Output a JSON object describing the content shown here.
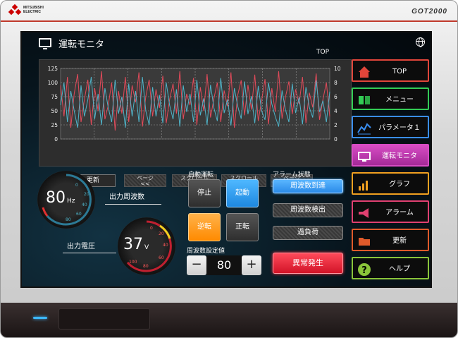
{
  "device": {
    "brand_line1": "MITSUBISHI",
    "brand_line2": "ELECTRIC",
    "model": "GOT2000"
  },
  "header": {
    "title": "運転モニタ",
    "top_label": "TOP",
    "icon": "monitor-icon",
    "globe_icon": "globe-icon"
  },
  "chart_data": {
    "type": "line",
    "y_left_ticks": [
      "125",
      "100",
      "75",
      "50",
      "25",
      "0"
    ],
    "y_right_ticks": [
      "10",
      "8",
      "6",
      "4",
      "2",
      "0"
    ],
    "ylim_left": [
      0,
      125
    ],
    "ylim_right": [
      0,
      10
    ],
    "grid": true,
    "series": [
      {
        "color": "#e24a5a",
        "values": [
          95,
          40,
          110,
          20,
          80,
          115,
          30,
          70,
          105,
          25,
          90,
          50,
          120,
          35,
          60,
          100,
          15,
          85,
          45,
          110,
          30,
          95,
          65,
          118,
          22,
          75,
          105,
          40,
          88,
          55,
          112,
          28,
          70,
          98,
          45,
          120,
          35,
          80,
          60,
          108,
          25,
          92,
          50,
          115,
          38,
          72,
          100,
          30,
          86,
          58,
          118,
          20,
          78,
          104,
          42,
          96,
          52,
          114,
          32,
          68,
          106,
          26,
          90,
          48,
          120,
          36,
          74,
          102,
          44,
          88,
          62,
          110,
          28,
          82,
          56,
          116,
          34,
          70,
          100,
          40
        ]
      },
      {
        "color": "#4fb3c8",
        "values": [
          60,
          100,
          30,
          85,
          50,
          20,
          95,
          40,
          70,
          110,
          35,
          80,
          25,
          90,
          55,
          30,
          105,
          45,
          75,
          20,
          98,
          40,
          85,
          30,
          110,
          50,
          25,
          92,
          40,
          78,
          28,
          100,
          60,
          35,
          88,
          22,
          95,
          48,
          80,
          30,
          105,
          42,
          72,
          25,
          96,
          55,
          32,
          108,
          46,
          70,
          24,
          90,
          58,
          36,
          102,
          44,
          76,
          28,
          94,
          50,
          34,
          100,
          62,
          40,
          22,
          86,
          52,
          30,
          98,
          46,
          74,
          26,
          92,
          56,
          38,
          104,
          48,
          68,
          30,
          84
        ]
      }
    ]
  },
  "chart_nav": {
    "new": "更新",
    "page_prev": [
      "ページ",
      "<<"
    ],
    "scroll_left": [
      "スクロール",
      "<"
    ],
    "scroll_right": [
      "スクロール",
      ">"
    ],
    "page_next": [
      "ページ",
      ">>"
    ]
  },
  "gauge_freq": {
    "value": "80",
    "unit": "Hz",
    "label": "出力周波数",
    "ticks": [
      "0",
      "20",
      "40",
      "60",
      "80",
      "100",
      "120"
    ]
  },
  "gauge_volt": {
    "value": "37",
    "unit": "V",
    "label": "出力電圧",
    "ticks": [
      "0",
      "20",
      "40",
      "60",
      "80",
      "100",
      "120"
    ]
  },
  "auto_run": {
    "label": "自動運転",
    "stop": "停止",
    "start": "起動",
    "reverse": "逆転",
    "forward": "正転"
  },
  "freq_setting": {
    "label": "周波数設定値",
    "value": "80",
    "minus": "−",
    "plus": "+"
  },
  "alarm_status": {
    "label": "アラーム状態",
    "items": [
      "周波数到達",
      "周波数検出",
      "過負荷"
    ],
    "error": "異常発生"
  },
  "side_menu": [
    {
      "label": "TOP",
      "icon": "home-icon",
      "border": "#e0453a"
    },
    {
      "label": "メニュー",
      "icon": "book-icon",
      "border": "#33cc55"
    },
    {
      "label": "パラメータ１",
      "icon": "parameter-chart-icon",
      "border": "#3a8ef0"
    },
    {
      "label": "運転モニタ",
      "icon": "monitor-icon",
      "border": "#d64cc4"
    },
    {
      "label": "グラフ",
      "icon": "bar-chart-icon",
      "border": "#f0a020"
    },
    {
      "label": "アラーム",
      "icon": "megaphone-icon",
      "border": "#e04070"
    },
    {
      "label": "更新",
      "icon": "folder-icon",
      "border": "#e05a2a"
    },
    {
      "label": "ヘルプ",
      "icon": "help-icon",
      "border": "#8ac43a"
    }
  ]
}
